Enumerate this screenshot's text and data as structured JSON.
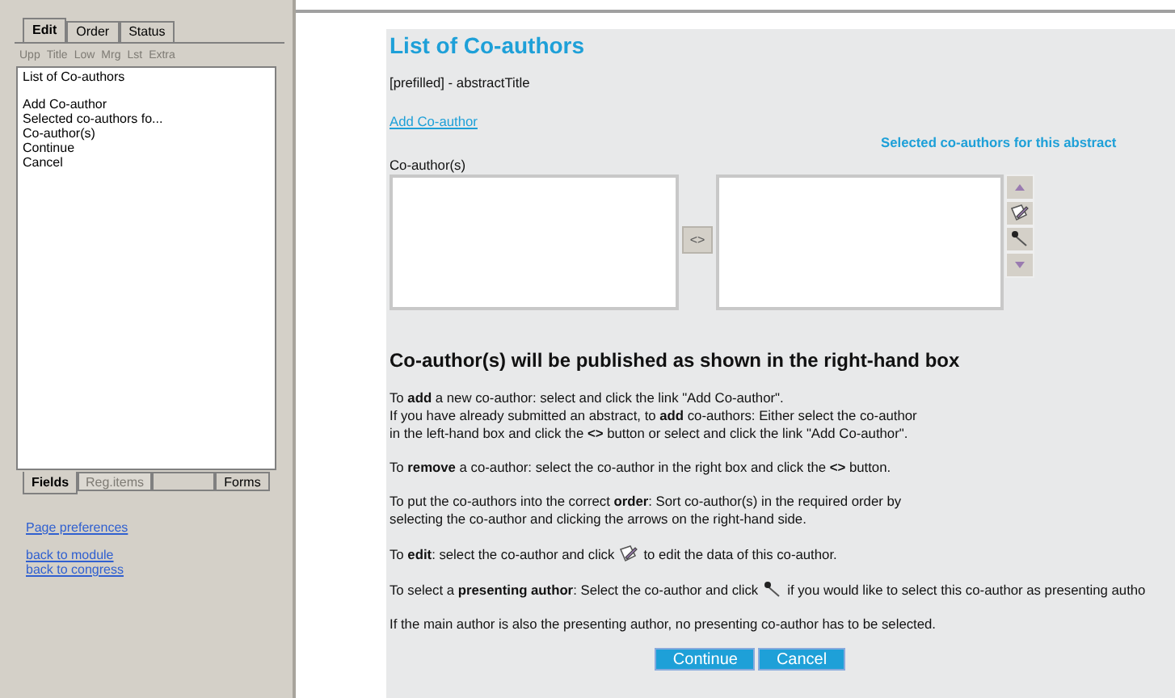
{
  "left_panel": {
    "tabs": [
      {
        "label": "Edit",
        "selected": true
      },
      {
        "label": "Order",
        "selected": false
      },
      {
        "label": "Status",
        "selected": false
      }
    ],
    "toolbar": [
      {
        "label": "Upp",
        "disabled": true
      },
      {
        "label": "Title",
        "disabled": true
      },
      {
        "label": "Low",
        "disabled": true
      },
      {
        "label": "Mrg",
        "disabled": true
      },
      {
        "label": "Lst",
        "disabled": true
      },
      {
        "label": "Extra",
        "disabled": true
      }
    ],
    "list_groups": [
      [
        "List of Co-authors"
      ],
      [
        "Add Co-author",
        "Selected co-authors fo...",
        "Co-author(s)",
        "Continue",
        "Cancel"
      ]
    ],
    "bottom_tabs": [
      {
        "label": "Fields",
        "selected": true,
        "disabled": false
      },
      {
        "label": "Reg.items",
        "selected": false,
        "disabled": true
      },
      {
        "selected": false
      },
      {
        "label": "Forms",
        "selected": false,
        "disabled": false
      }
    ],
    "link_groups": [
      [
        "Page preferences"
      ],
      [
        "back to module",
        "back to congress"
      ]
    ]
  },
  "main": {
    "title": "List of Co-authors",
    "subtitle": "[prefilled] - abstractTitle",
    "add_link": "Add Co-author",
    "selected_heading": "Selected co-authors for this abstract",
    "coauthors_label": "Co-author(s)",
    "transfer_button": "<>",
    "notice": "Co-author(s) will be published as shown in the right-hand box",
    "paragraphs": [
      {
        "kind": "text",
        "lines": [
          "To **add** a new co-author: select and click the link  \"Add Co-author\".",
          "If you have already submitted an abstract, to **add** co-authors: Either select the co-author",
          "in the left-hand box and click the **<>** button or select and click the link \"Add Co-author\"."
        ]
      },
      {
        "kind": "text",
        "lines": [
          "To **remove** a co-author: select the co-author in the right box and click the **<>** button."
        ]
      },
      {
        "kind": "text",
        "lines": [
          "To put the co-authors into the correct  **order**: Sort co-author(s) in the required order by",
          "selecting the co-author and clicking the arrows on the right-hand side."
        ]
      },
      {
        "kind": "edit_icon",
        "before": "To **edit**: select the co-author and click",
        "after": "to edit the data of this co-author."
      },
      {
        "kind": "mic_icon",
        "before": "To select a **presenting author**: Select the co-author and click",
        "after": "if you would like to select this co-author as presenting autho"
      },
      {
        "kind": "text",
        "lines": [
          "If the main author is also the presenting author, no presenting co-author has to be selected."
        ]
      }
    ],
    "buttons": [
      "Continue",
      "Cancel"
    ]
  }
}
